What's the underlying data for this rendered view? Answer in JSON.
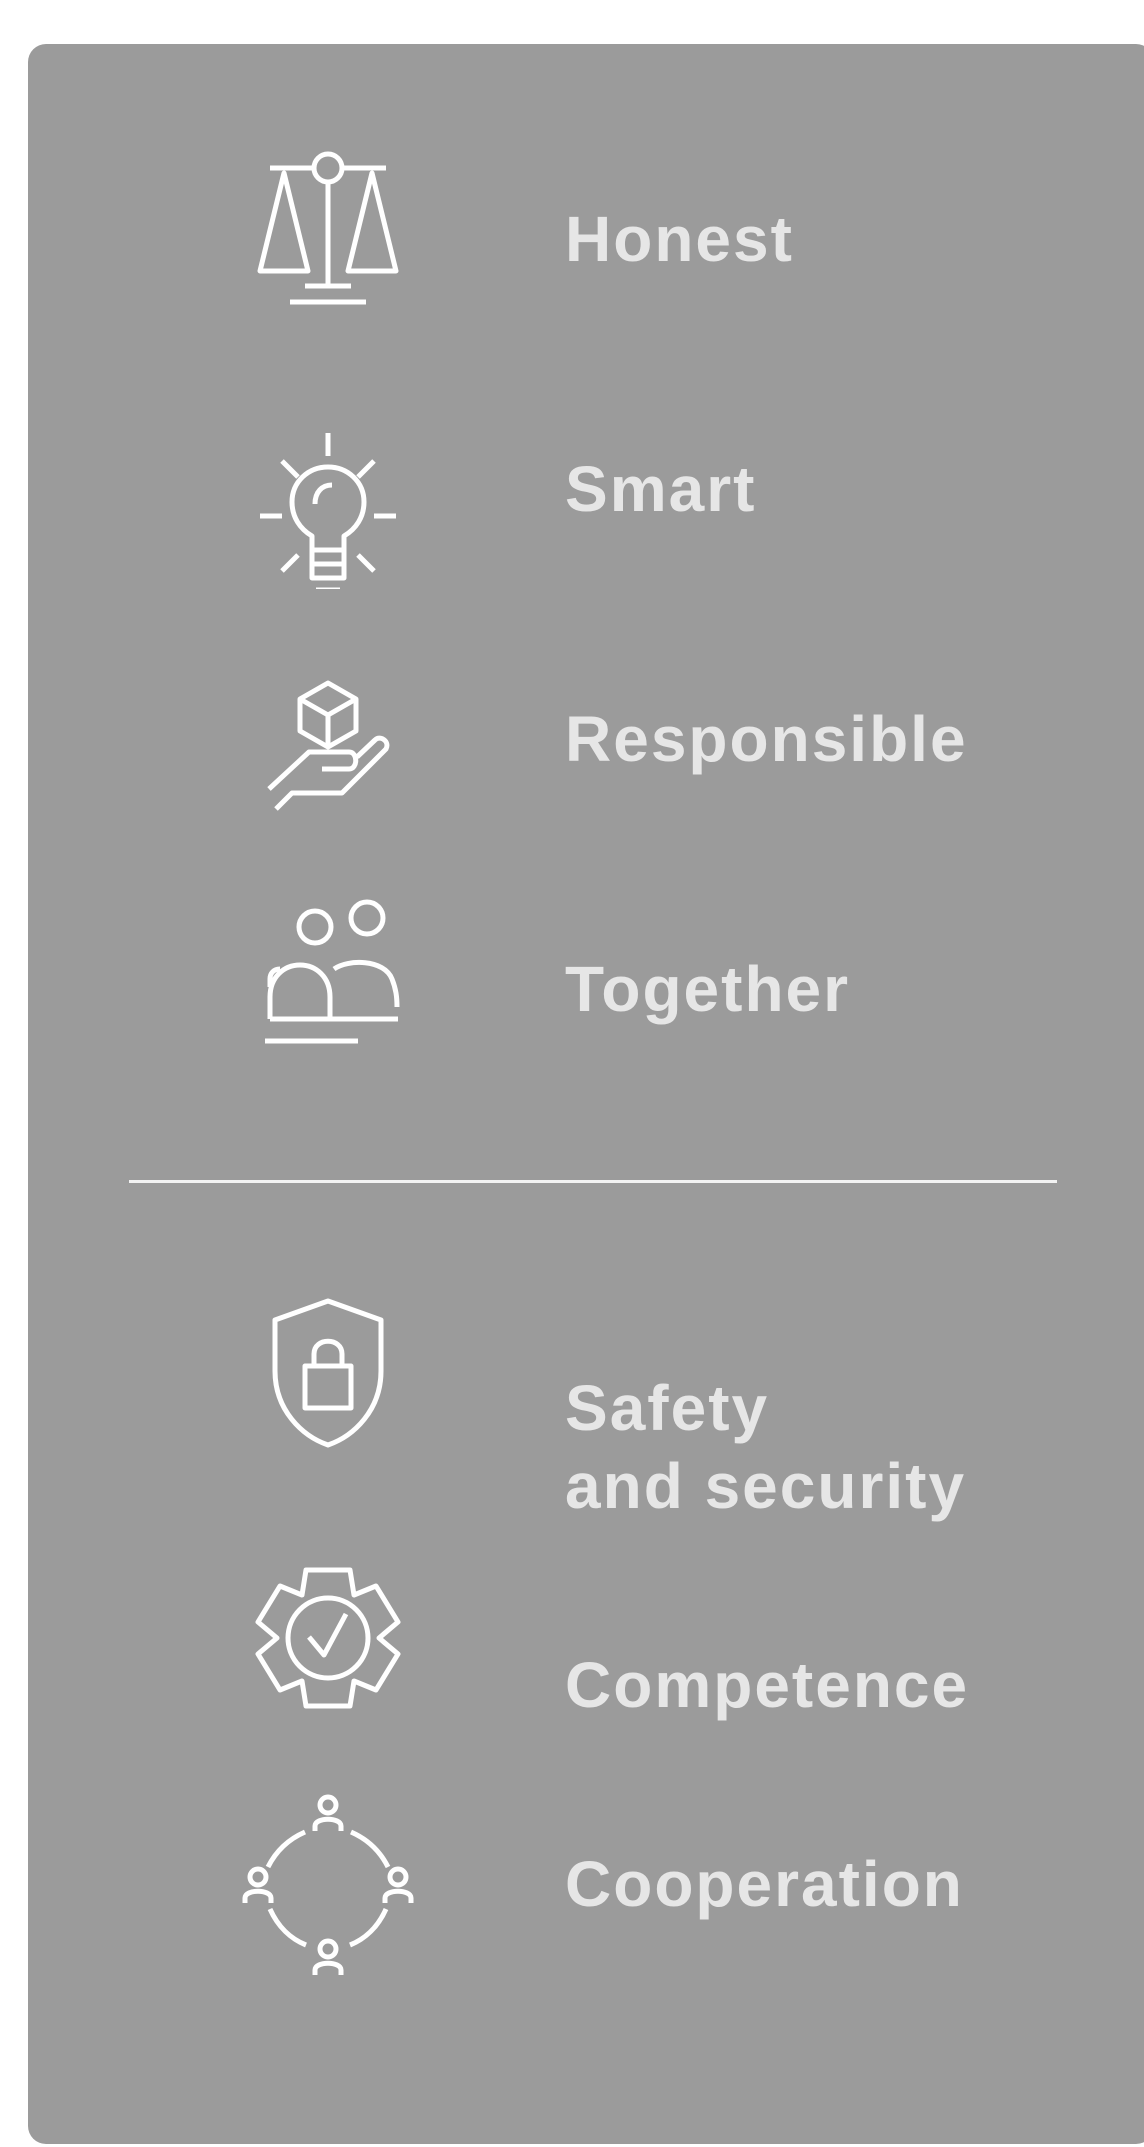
{
  "values_top": [
    {
      "label": "Honest",
      "icon": "scales-icon"
    },
    {
      "label": "Smart",
      "icon": "lightbulb-icon"
    },
    {
      "label": "Responsible",
      "icon": "hand-holding-box-icon"
    },
    {
      "label": "Together",
      "icon": "people-group-icon"
    }
  ],
  "values_bottom": [
    {
      "label_line1": "Safety",
      "label_line2": "and security",
      "icon": "shield-lock-icon"
    },
    {
      "label": "Competence",
      "icon": "gear-check-icon"
    },
    {
      "label": "Cooperation",
      "icon": "people-circle-icon"
    }
  ],
  "colors": {
    "panel": "#9b9b9b",
    "text": "#e6e6e6",
    "icon": "#ffffff",
    "background": "#ffffff"
  }
}
